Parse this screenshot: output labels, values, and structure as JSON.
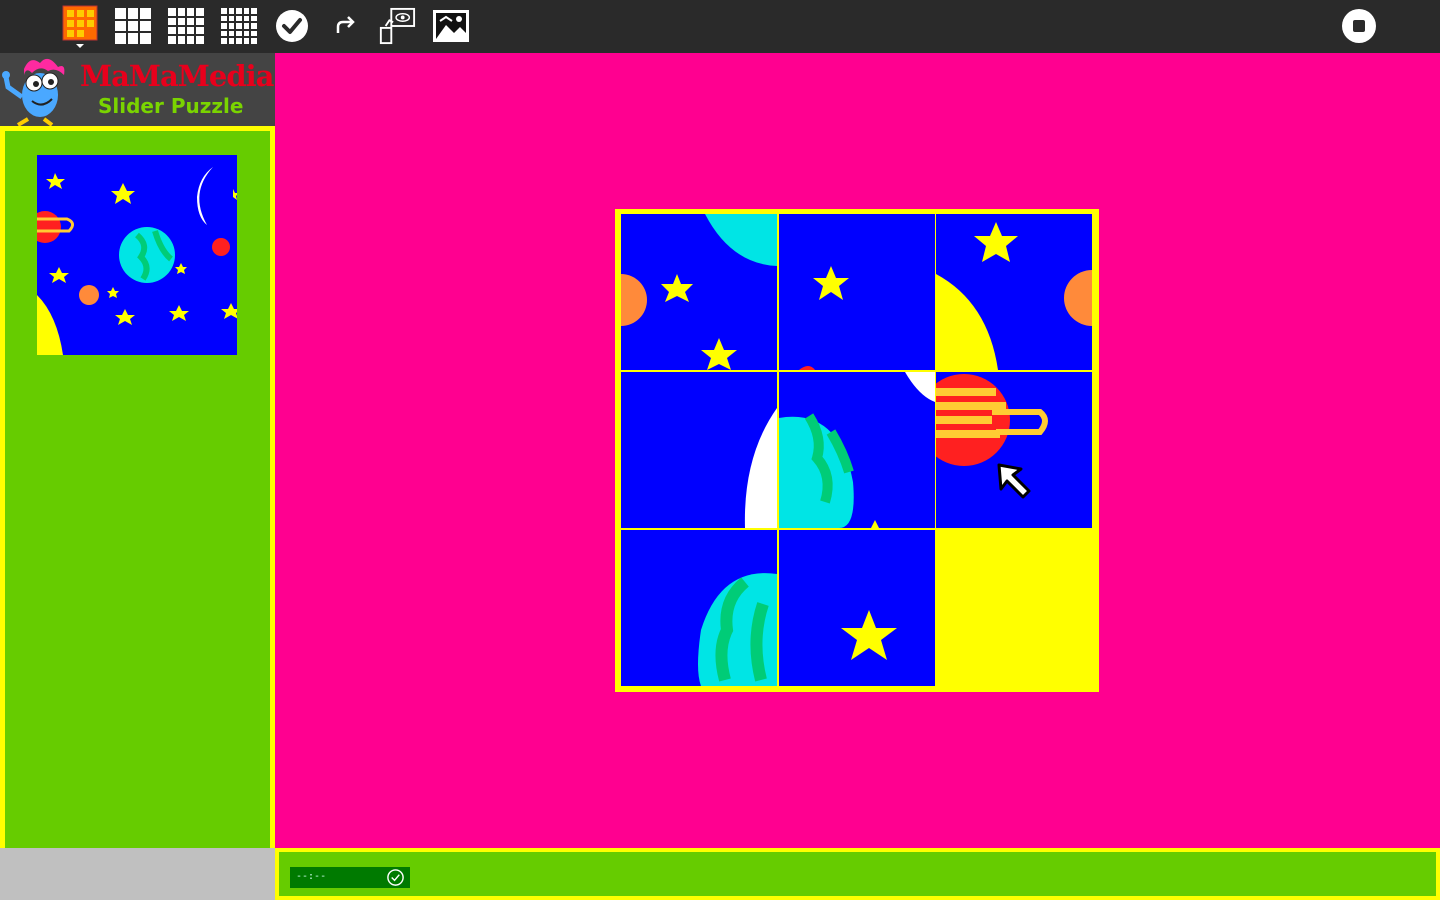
{
  "app": {
    "title_part1": "MaMaMedia",
    "title_part2": "Slider Puzzle"
  },
  "toolbar": {
    "items": [
      {
        "name": "puzzle-menu-icon"
      },
      {
        "name": "grid-3x3-icon"
      },
      {
        "name": "grid-4x4-icon"
      },
      {
        "name": "grid-5x5-icon"
      },
      {
        "name": "check-icon"
      },
      {
        "name": "redo-icon"
      },
      {
        "name": "peek-icon"
      },
      {
        "name": "change-picture-icon"
      }
    ],
    "stop_icon": "stop-icon"
  },
  "puzzle": {
    "grid_size": 3,
    "empty_position": "bottom-right",
    "colors": {
      "background": "#ff0090",
      "board_frame": "#ffff00",
      "panel": "#66cc00",
      "sky": "#0000ff"
    }
  },
  "status": {
    "timer": "--:--"
  }
}
